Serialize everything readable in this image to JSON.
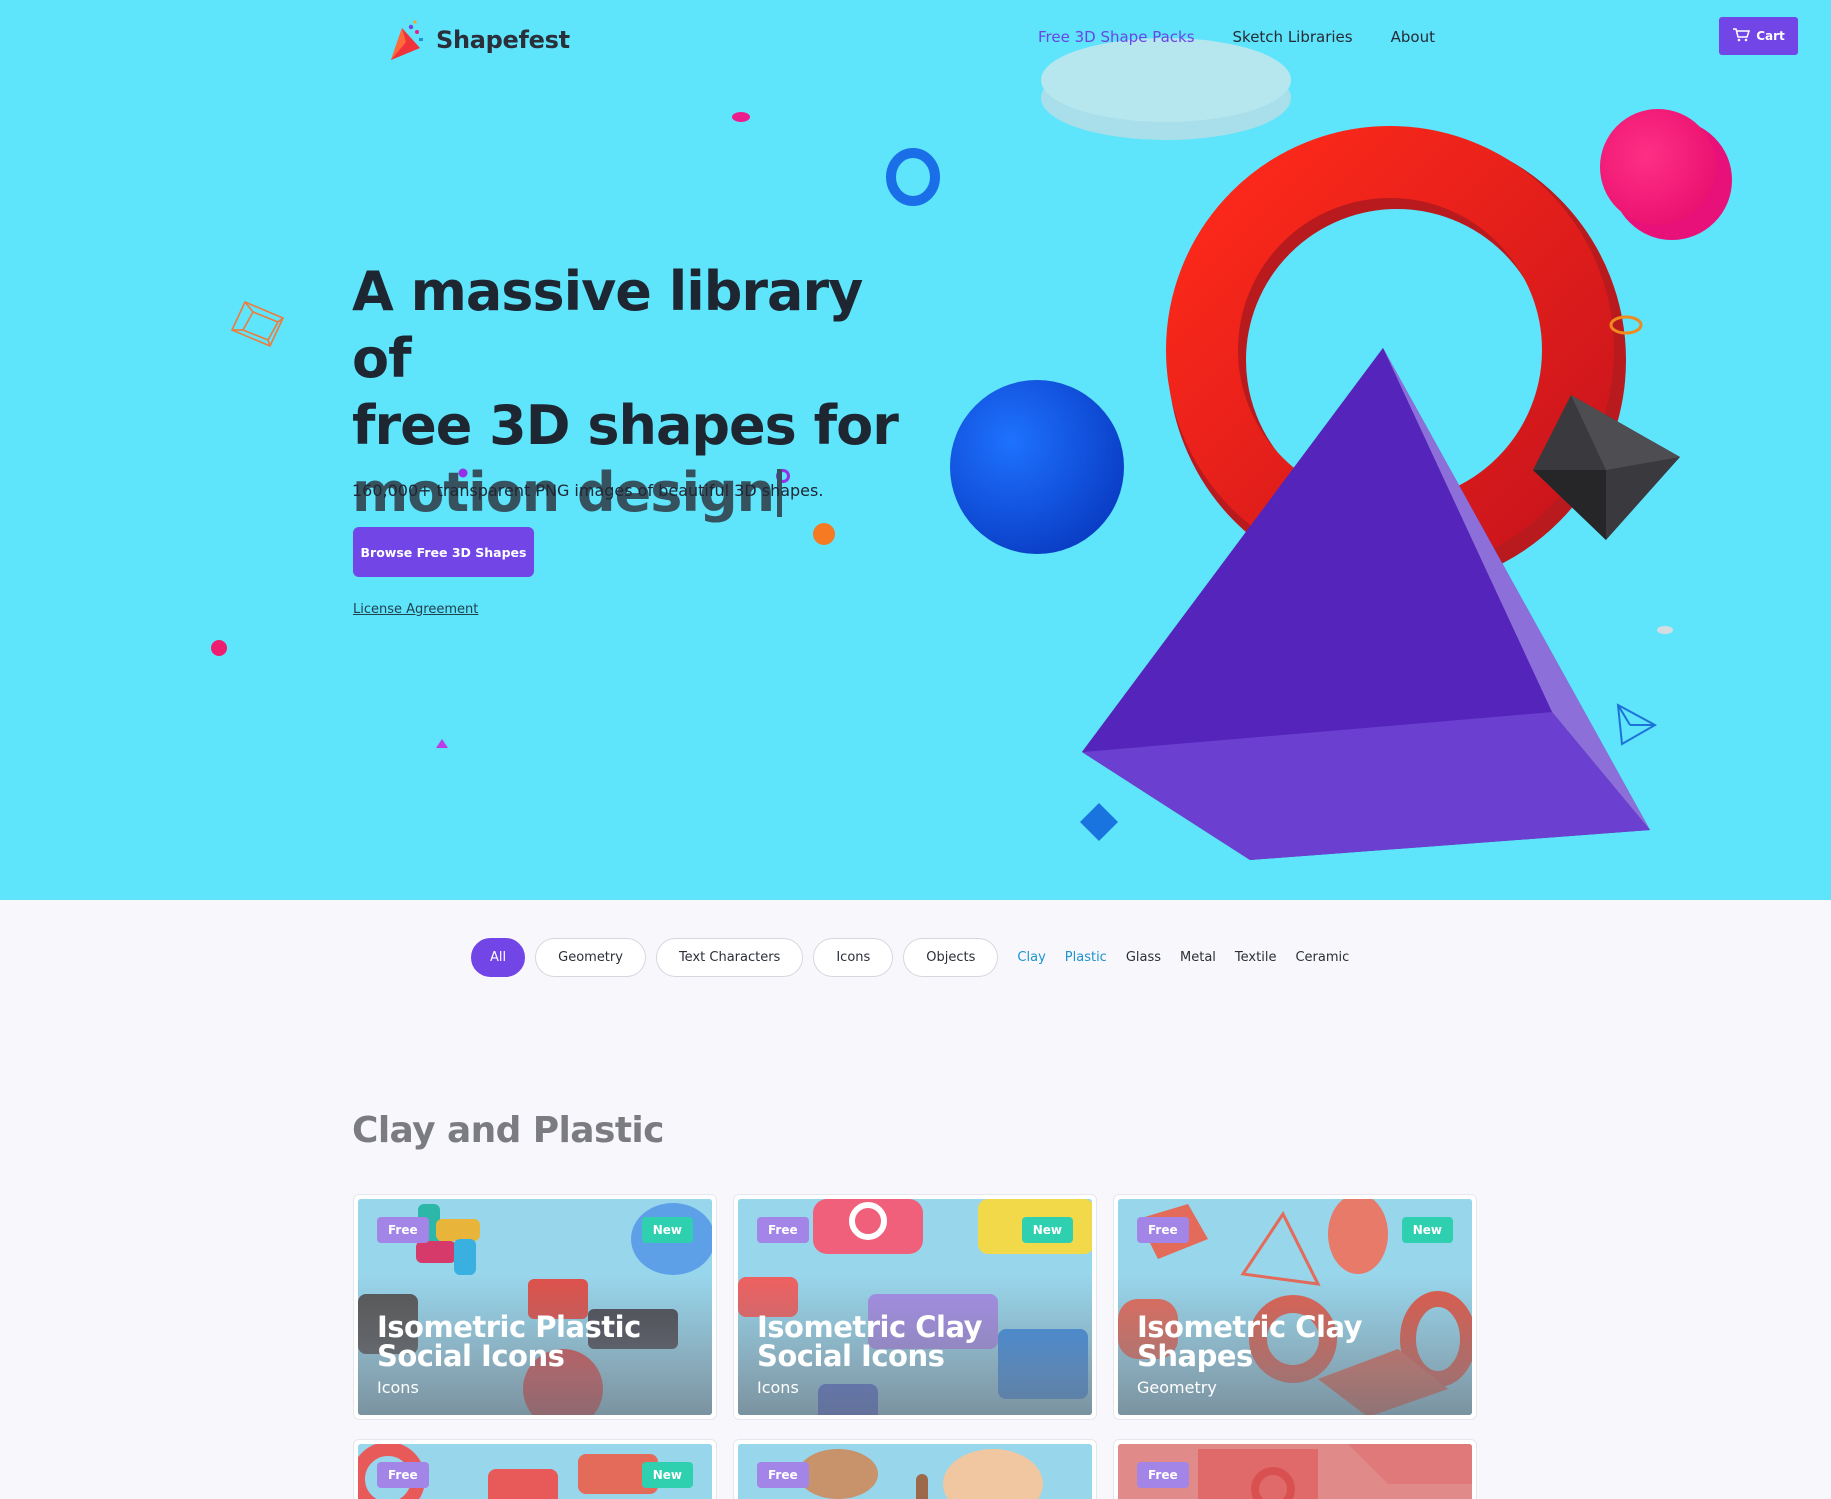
{
  "brand": {
    "name": "Shapefest"
  },
  "nav": {
    "items": [
      {
        "label": "Free 3D Shape Packs",
        "active": true
      },
      {
        "label": "Sketch Libraries",
        "active": false
      },
      {
        "label": "About",
        "active": false
      }
    ],
    "cart_label": "Cart"
  },
  "hero": {
    "headline_line1": "A massive library of",
    "headline_line2": "free 3D shapes for",
    "headline_line3": "motion design",
    "subhead": "160,000+ transparent PNG images of beautiful 3D shapes.",
    "cta_label": "Browse Free 3D Shapes",
    "license_label": "License Agreement"
  },
  "filters": {
    "categories": [
      "All",
      "Geometry",
      "Text Characters",
      "Icons",
      "Objects"
    ],
    "materials": [
      "Clay",
      "Plastic",
      "Glass",
      "Metal",
      "Textile",
      "Ceramic"
    ]
  },
  "section": {
    "title": "Clay and Plastic",
    "cards": [
      {
        "title": "Isometric Plastic Social Icons",
        "category": "Icons",
        "badge_free": "Free",
        "badge_new": "New"
      },
      {
        "title": "Isometric Clay Social Icons",
        "category": "Icons",
        "badge_free": "Free",
        "badge_new": "New"
      },
      {
        "title": "Isometric Clay Shapes",
        "category": "Geometry",
        "badge_free": "Free",
        "badge_new": "New"
      },
      {
        "badge_free": "Free",
        "badge_new": "New"
      },
      {
        "badge_free": "Free"
      },
      {
        "badge_free": "Free"
      }
    ]
  },
  "colors": {
    "hero_bg": "#5ee4fb",
    "accent": "#7145e6",
    "badge_free": "#a385e8",
    "badge_new": "#2fd0b0"
  }
}
